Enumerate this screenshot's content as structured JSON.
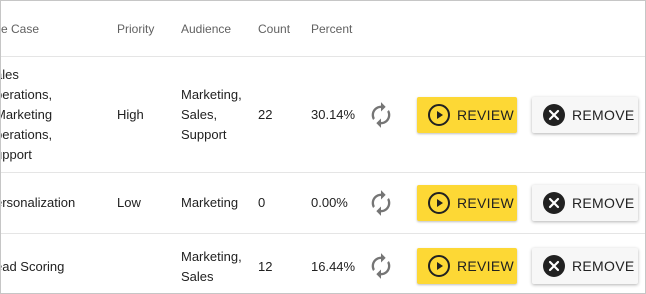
{
  "headers": {
    "use_case": "se Case",
    "priority": "Priority",
    "audience": "Audience",
    "count": "Count",
    "percent": "Percent"
  },
  "rows": [
    {
      "use_case_lines": [
        "ales",
        "perations,",
        "Marketing",
        "perations,",
        "upport"
      ],
      "priority": "High",
      "audience_lines": [
        "Marketing,",
        "Sales,",
        "Support"
      ],
      "count": "22",
      "percent": "30.14%",
      "review_label": "REVIEW",
      "remove_label": "REMOVE"
    },
    {
      "use_case_lines": [
        "ersonalization"
      ],
      "priority": "Low",
      "audience_lines": [
        "Marketing"
      ],
      "count": "0",
      "percent": "0.00%",
      "review_label": "REVIEW",
      "remove_label": "REMOVE"
    },
    {
      "use_case_lines": [
        "ead Scoring"
      ],
      "priority": "",
      "audience_lines": [
        "Marketing,",
        "Sales"
      ],
      "count": "12",
      "percent": "16.44%",
      "review_label": "REVIEW",
      "remove_label": "REMOVE"
    }
  ],
  "icons": {
    "refresh": "refresh-icon",
    "review": "play-circle-icon",
    "remove": "close-circle-icon"
  },
  "colors": {
    "review_button": "#fdd835",
    "remove_button": "#f7f7f7",
    "icon_gray": "#757575",
    "text": "#212121"
  }
}
